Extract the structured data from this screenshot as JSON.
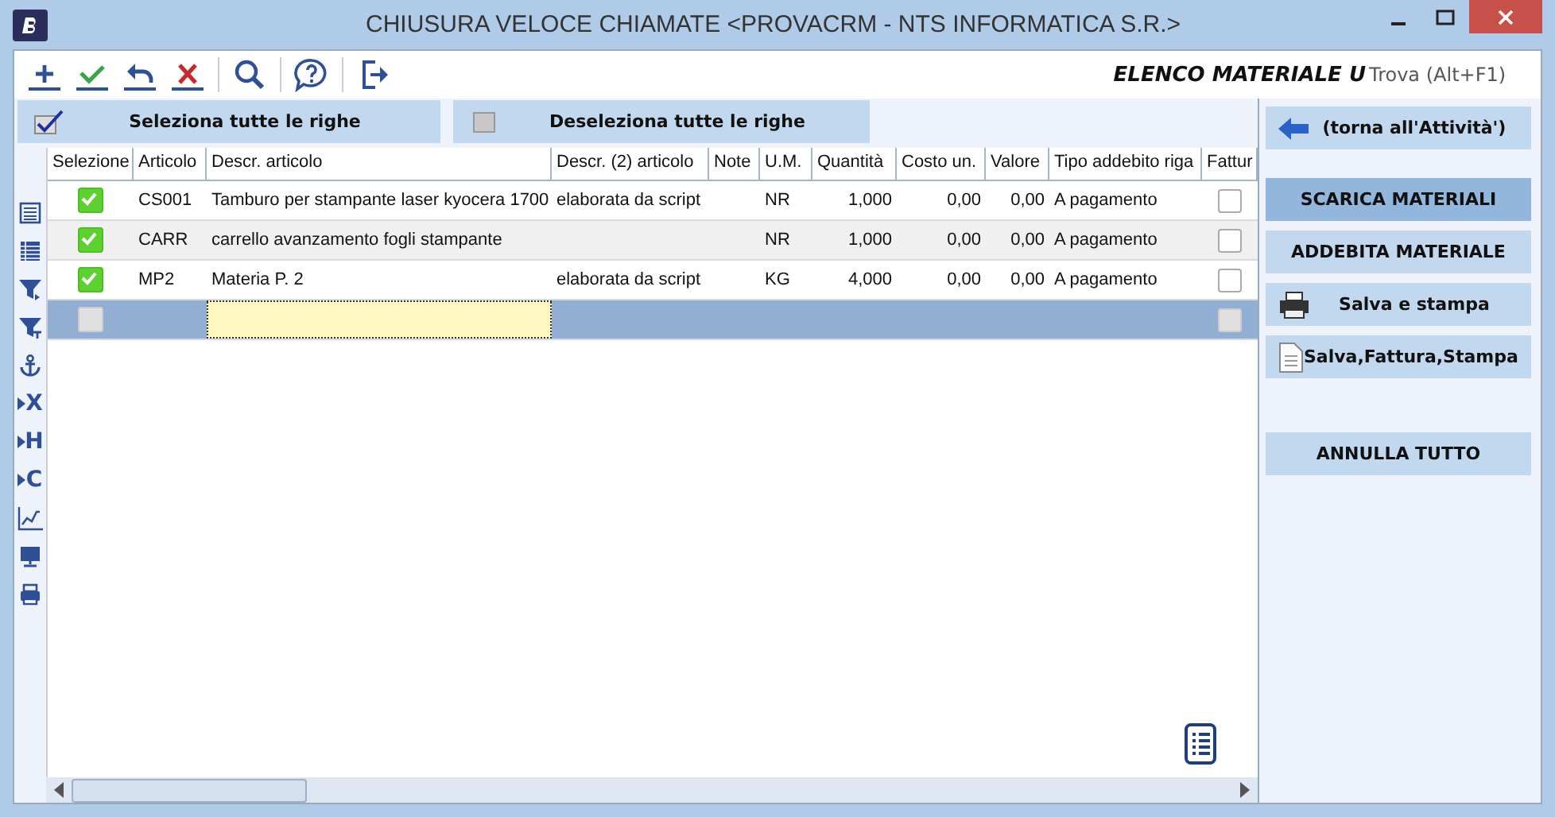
{
  "window": {
    "title": "CHIUSURA VELOCE CHIAMATE <PROVACRM - NTS INFORMATICA S.R.>"
  },
  "toolbar": {
    "heading": "ELENCO MATERIALE U",
    "search": {
      "placeholder": "Trova (Alt+F1)"
    }
  },
  "select_buttons": [
    {
      "kind": "select",
      "label": "Seleziona tutte le righe"
    },
    {
      "kind": "deselect",
      "label": "Deseleziona tutte le righe"
    }
  ],
  "side_tools": [
    {
      "kind": "list"
    },
    {
      "kind": "grid"
    },
    {
      "kind": "filter"
    },
    {
      "kind": "filter2"
    },
    {
      "kind": "anchor"
    },
    {
      "kind": "letter",
      "label": "X"
    },
    {
      "kind": "letter",
      "label": "H"
    },
    {
      "kind": "letter",
      "label": "C"
    },
    {
      "kind": "chart"
    },
    {
      "kind": "monitor"
    },
    {
      "kind": "printer"
    }
  ],
  "table": {
    "columns": [
      "Selezione",
      "Articolo",
      "Descr. articolo",
      "Descr. (2) articolo",
      "Note",
      "U.M.",
      "Quantità",
      "Costo un.",
      "Valore",
      "Tipo addebito riga",
      "Fattur"
    ],
    "rows": [
      {
        "selected": false,
        "checked": true,
        "invoiced": false,
        "cells": [
          "",
          "CS001",
          "Tamburo per stampante laser kyocera 1700",
          "elaborata da script",
          "",
          "NR",
          "1,000",
          "0,00",
          "0,00",
          "A pagamento",
          ""
        ]
      },
      {
        "selected": false,
        "checked": true,
        "invoiced": false,
        "cells": [
          "",
          "CARR",
          "carrello avanzamento fogli stampante",
          "",
          "",
          "NR",
          "1,000",
          "0,00",
          "0,00",
          "A pagamento",
          ""
        ]
      },
      {
        "selected": false,
        "checked": true,
        "invoiced": false,
        "cells": [
          "",
          "MP2",
          "Materia P. 2",
          "elaborata da script",
          "",
          "KG",
          "4,000",
          "0,00",
          "0,00",
          "A pagamento",
          ""
        ]
      },
      {
        "selected": true,
        "checked": false,
        "invoiced": false,
        "cells": [
          "",
          "",
          "",
          "",
          "",
          "",
          "",
          "",
          "",
          "",
          ""
        ]
      }
    ]
  },
  "actions": [
    {
      "kind": "back",
      "label": "(torna all'Attività')",
      "selected": false
    },
    {
      "kind": "plain",
      "label": "SCARICA MATERIALI",
      "selected": true
    },
    {
      "kind": "plain",
      "label": "ADDEBITA MATERIALE",
      "selected": false
    },
    {
      "kind": "print",
      "label": "Salva e stampa",
      "selected": false
    },
    {
      "kind": "doc",
      "label": "Salva,Fattura,Stampa",
      "selected": false
    },
    {
      "kind": "gap"
    },
    {
      "kind": "plain",
      "label": "ANNULLA TUTTO",
      "selected": false
    }
  ]
}
